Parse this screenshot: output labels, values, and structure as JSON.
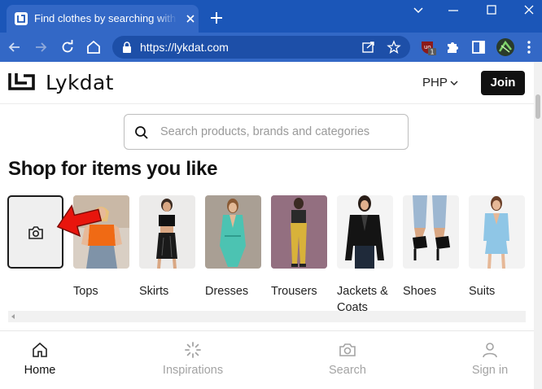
{
  "browser": {
    "tab_title": "Find clothes by searching with images",
    "url": "https://lykdat.com",
    "extension_badge": "1"
  },
  "header": {
    "logo_text": "Lykdat",
    "currency": "PHP",
    "join_label": "Join"
  },
  "search": {
    "placeholder": "Search products, brands and categories"
  },
  "shop": {
    "title": "Shop for items you like",
    "categories": [
      {
        "label": "Tops",
        "icon": "tops-photo"
      },
      {
        "label": "Skirts",
        "icon": "skirts-photo"
      },
      {
        "label": "Dresses",
        "icon": "dresses-photo"
      },
      {
        "label": "Trousers",
        "icon": "trousers-photo"
      },
      {
        "label": "Jackets & Coats",
        "icon": "jackets-photo"
      },
      {
        "label": "Shoes",
        "icon": "shoes-photo"
      },
      {
        "label": "Suits",
        "icon": "suits-photo"
      }
    ]
  },
  "bottom_nav": {
    "home": "Home",
    "inspirations": "Inspirations",
    "search": "Search",
    "signin": "Sign in"
  },
  "colors": {
    "chrome_title": "#1b56b8",
    "chrome_toolbar": "#3368c6",
    "annotation_arrow": "#e8150d"
  }
}
